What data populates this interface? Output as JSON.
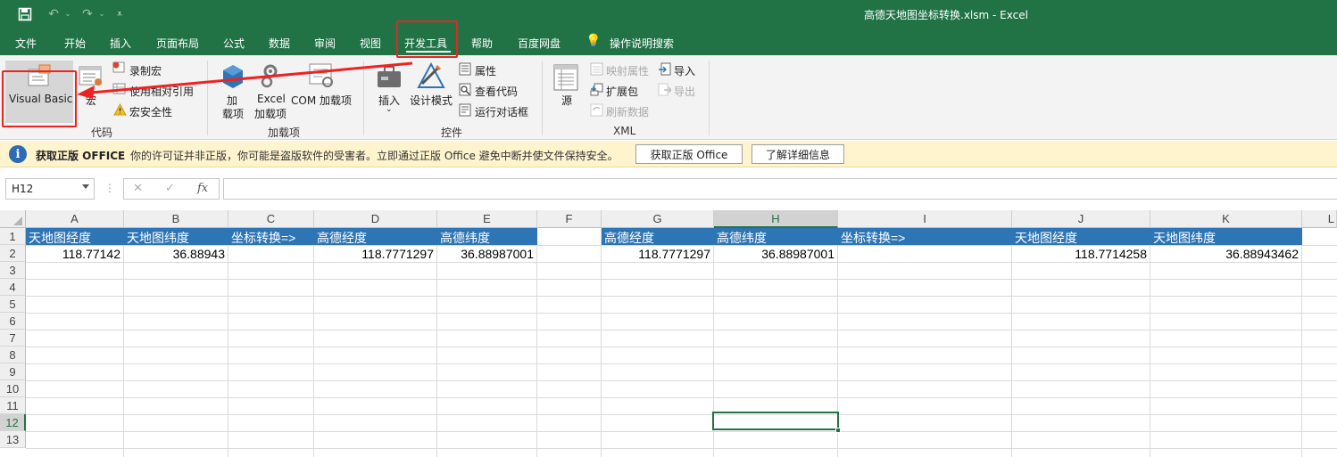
{
  "title_bar": {
    "title": "高德天地图坐标转换.xlsm  -  Excel",
    "save_icon": "save-icon",
    "undo_icon": "undo-icon",
    "redo_icon": "redo-icon",
    "customize_icon": "customize-qat-icon"
  },
  "tabs": [
    "文件",
    "开始",
    "插入",
    "页面布局",
    "公式",
    "数据",
    "审阅",
    "视图",
    "开发工具",
    "帮助",
    "百度网盘"
  ],
  "active_tab": "开发工具",
  "tell_me": "操作说明搜索",
  "ribbon": {
    "code": {
      "visual_basic": "Visual Basic",
      "macros": "宏",
      "record_macro": "录制宏",
      "relative_ref": "使用相对引用",
      "macro_security": "宏安全性",
      "label": "代码"
    },
    "addins": {
      "addins_line1": "加",
      "addins_line2": "载项",
      "excel_addins_line1": "Excel",
      "excel_addins_line2": "加载项",
      "com_addins": "COM 加载项",
      "label": "加载项"
    },
    "controls": {
      "insert": "插入",
      "design_mode": "设计模式",
      "properties": "属性",
      "view_code": "查看代码",
      "run_dialog": "运行对话框",
      "label": "控件"
    },
    "xml": {
      "source": "源",
      "map_properties": "映射属性",
      "expansion_packs": "扩展包",
      "refresh_data": "刷新数据",
      "import": "导入",
      "export": "导出",
      "label": "XML"
    }
  },
  "info_bar": {
    "title": "获取正版 OFFICE",
    "message": "你的许可证并非正版，你可能是盗版软件的受害者。立即通过正版 Office 避免中断并使文件保持安全。",
    "button_get": "获取正版 Office",
    "button_learn": "了解详细信息"
  },
  "formula_bar": {
    "name_box": "H12",
    "cancel": "✕",
    "enter": "✓",
    "fx": "fx",
    "formula": ""
  },
  "columns": [
    "A",
    "B",
    "C",
    "D",
    "E",
    "F",
    "G",
    "H",
    "I",
    "J",
    "K",
    "L"
  ],
  "selected_column": "H",
  "rows": [
    "1",
    "2",
    "3",
    "4",
    "5",
    "6",
    "7",
    "8",
    "9",
    "10",
    "11",
    "12",
    "13"
  ],
  "selected_row": "12",
  "cells": {
    "A1": "天地图经度",
    "B1": "天地图纬度",
    "C1": "坐标转换=>",
    "D1": "高德经度",
    "E1": "高德纬度",
    "G1": "高德经度",
    "H1": "高德纬度",
    "I1": "坐标转换=>",
    "J1": "天地图经度",
    "K1": "天地图纬度",
    "A2": "118.77142",
    "B2": "36.88943",
    "D2": "118.7771297",
    "E2": "36.88987001",
    "G2": "118.7771297",
    "H2": "36.88987001",
    "J2": "118.7714258",
    "K2": "36.88943462"
  },
  "colors": {
    "excel_green": "#217346",
    "header_blue": "#2e75b6",
    "annotation_red": "#ee2222",
    "info_yellow": "#fff4ce"
  }
}
